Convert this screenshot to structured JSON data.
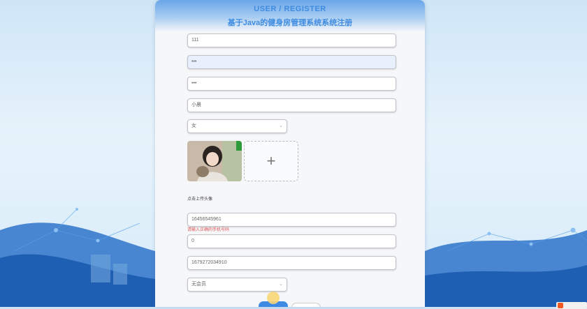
{
  "header": {
    "title_en": "USER / REGISTER",
    "title_cn": "基于Java的健身房管理系统系统注册"
  },
  "form": {
    "account": "111",
    "password": "•••",
    "confirm_password": "•••",
    "name": "小晨",
    "gender_selected": "女",
    "avatar_label": "点击上传头像",
    "phone": "16456545961",
    "phone_error": "请输入正确的手机号码",
    "field_zero": "0",
    "field_number": "1679272034910",
    "membership_selected": "无会员"
  },
  "colors": {
    "accent": "#3f8be0",
    "error": "#e05a5a"
  }
}
